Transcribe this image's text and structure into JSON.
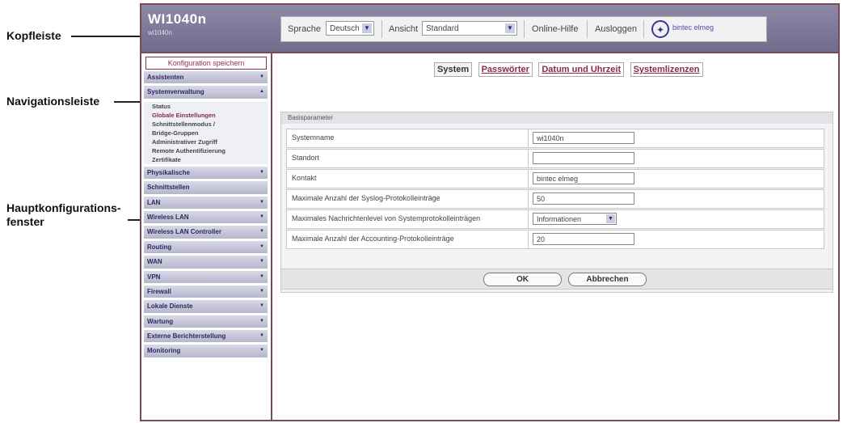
{
  "annotations": {
    "header_label": "Kopfleiste",
    "nav_label": "Navigationsleiste",
    "main_label_line1": "Hauptkonfigurations-",
    "main_label_line2": "fenster"
  },
  "header": {
    "title": "WI1040n",
    "subtitle": "wi1040n",
    "language_label": "Sprache",
    "language_value": "Deutsch",
    "view_label": "Ansicht",
    "view_value": "Standard",
    "online_help": "Online-Hilfe",
    "logout": "Ausloggen",
    "logo_text": "bintec elmeg"
  },
  "sidebar": {
    "save_label": "Konfiguration speichern",
    "items": [
      {
        "label": "Assistenten",
        "arrow": "▼"
      },
      {
        "label": "Systemverwaltung",
        "arrow": "▲"
      },
      {
        "label": "Physikalische",
        "arrow": "▼"
      },
      {
        "label": "Schnittstellen",
        "arrow": ""
      },
      {
        "label": "LAN",
        "arrow": "▼"
      },
      {
        "label": "Wireless LAN",
        "arrow": "▼"
      },
      {
        "label": "Wireless LAN Controller",
        "arrow": "▼"
      },
      {
        "label": "Routing",
        "arrow": "▼"
      },
      {
        "label": "WAN",
        "arrow": "▼"
      },
      {
        "label": "VPN",
        "arrow": "▼"
      },
      {
        "label": "Firewall",
        "arrow": "▼"
      },
      {
        "label": "Lokale Dienste",
        "arrow": "▼"
      },
      {
        "label": "Wartung",
        "arrow": "▼"
      },
      {
        "label": "Externe Berichterstellung",
        "arrow": "▼"
      },
      {
        "label": "Monitoring",
        "arrow": "▼"
      }
    ],
    "subitems": [
      "Status",
      "Globale Einstellungen",
      "Schnittstellenmodus /",
      "Bridge-Gruppen",
      "Administrativer Zugriff",
      "Remote Authentifizierung",
      "Zertifikate"
    ]
  },
  "main": {
    "tabs": [
      "System",
      "Passwörter",
      "Datum und Uhrzeit",
      "Systemlizenzen"
    ],
    "panel_title": "Basisparameter",
    "rows": [
      {
        "label": "Systemname",
        "value": "wi1040n"
      },
      {
        "label": "Standort",
        "value": ""
      },
      {
        "label": "Kontakt",
        "value": "bintec elmeg"
      },
      {
        "label": "Maximale Anzahl der Syslog-Protokolleinträge",
        "value": "50"
      },
      {
        "label": "Maximales Nachrichtenlevel von Systemprotokolleinträgen",
        "value": "Informationen"
      },
      {
        "label": "Maximale Anzahl der Accounting-Protokolleinträge",
        "value": "20"
      }
    ],
    "ok_label": "OK",
    "cancel_label": "Abbrechen"
  },
  "colors": {
    "frame": "#7a4a5a",
    "header_bg": "#7d7a9a",
    "nav_accent": "#8a2a4a"
  }
}
